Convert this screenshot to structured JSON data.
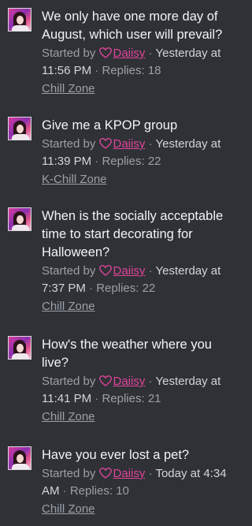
{
  "started_by_label": "Started by",
  "replies_label": "Replies:",
  "threads": [
    {
      "title": "We only have one more day of August, which user will prevail?",
      "user": "Daiisy",
      "time": "Yesterday at 11:56 PM",
      "replies": "18",
      "forum": "Chill Zone"
    },
    {
      "title": "Give me a KPOP group",
      "user": "Daiisy",
      "time": "Yesterday at 11:39 PM",
      "replies": "22",
      "forum": "K-Chill Zone"
    },
    {
      "title": "When is the socially acceptable time to start decorating for Halloween?",
      "user": "Daiisy",
      "time": "Yesterday at 7:37 PM",
      "replies": "22",
      "forum": "Chill Zone"
    },
    {
      "title": "How's the weather where you live?",
      "user": "Daiisy",
      "time": "Yesterday at 11:41 PM",
      "replies": "21",
      "forum": "Chill Zone"
    },
    {
      "title": "Have you ever lost a pet?",
      "user": "Daiisy",
      "time": "Today at 4:34 AM",
      "replies": "10",
      "forum": "Chill Zone"
    }
  ]
}
